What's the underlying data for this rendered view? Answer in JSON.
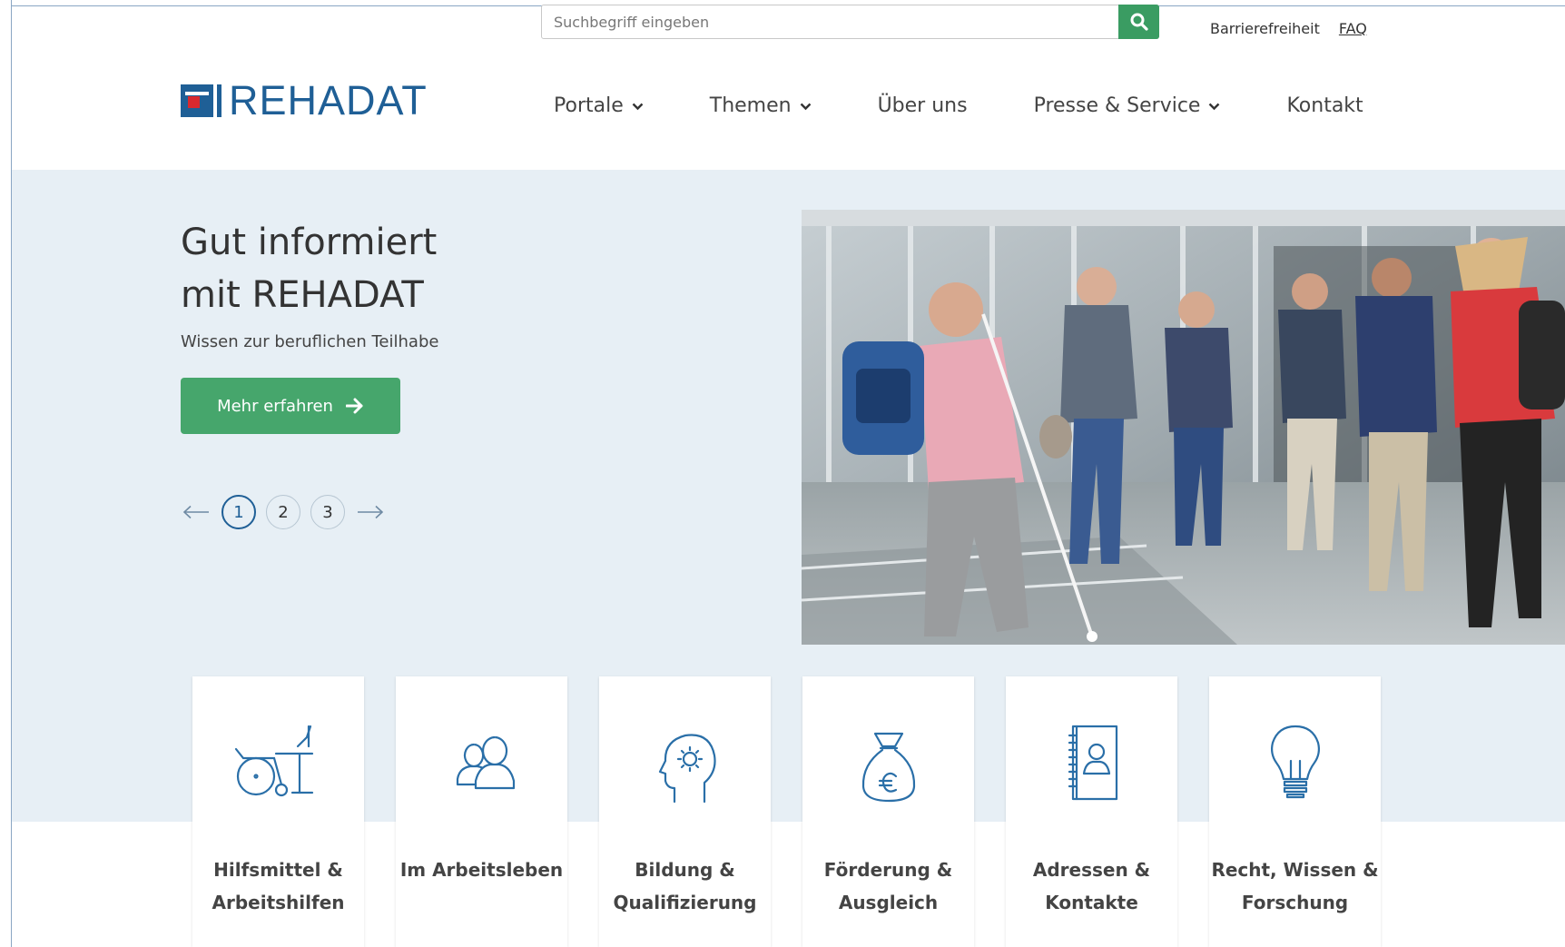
{
  "header": {
    "search": {
      "placeholder": "Suchbegriff eingeben",
      "value": "",
      "button_icon": "search-icon"
    },
    "toplinks": [
      {
        "label": "Barrierefreiheit"
      },
      {
        "label": "FAQ"
      }
    ],
    "logo_text": "REHADAT",
    "nav": [
      {
        "label": "Portale",
        "dropdown": true
      },
      {
        "label": "Themen",
        "dropdown": true
      },
      {
        "label": "Über uns",
        "dropdown": false
      },
      {
        "label": "Presse & Service",
        "dropdown": true
      },
      {
        "label": "Kontakt",
        "dropdown": false
      }
    ]
  },
  "hero": {
    "title_line1": "Gut informiert",
    "title_line2": "mit REHADAT",
    "subtitle": "Wissen zur beruflichen Teilhabe",
    "button_label": "Mehr erfahren",
    "pager": {
      "pages": [
        "1",
        "2",
        "3"
      ],
      "active": "1"
    }
  },
  "cards": [
    {
      "label": "Hilfsmittel &\nArbeitshilfen",
      "icon": "wheelchair-desk-icon"
    },
    {
      "label": "Im Arbeitsleben",
      "icon": "people-icon"
    },
    {
      "label": "Bildung &\nQualifizierung",
      "icon": "head-gear-icon"
    },
    {
      "label": "Förderung &\nAusgleich",
      "icon": "money-bag-icon"
    },
    {
      "label": "Adressen &\nKontakte",
      "icon": "address-book-icon"
    },
    {
      "label": "Recht, Wissen &\nForschung",
      "icon": "lightbulb-icon"
    }
  ],
  "colors": {
    "brand_blue": "#1f5f96",
    "brand_red": "#d8292f",
    "accent_green": "#46a66c",
    "hero_bg": "#e7eff5"
  }
}
